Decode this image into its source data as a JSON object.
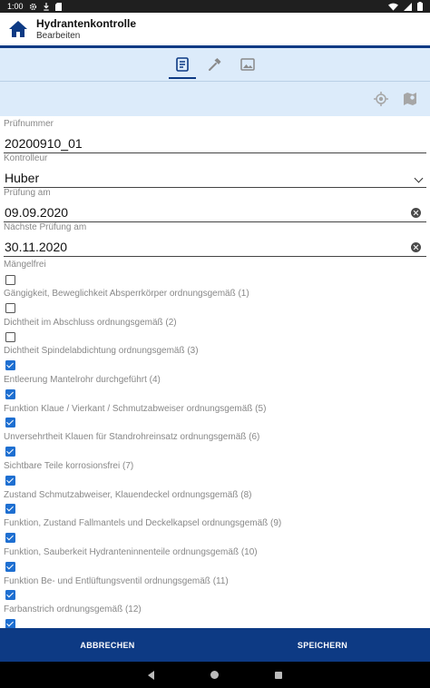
{
  "statusbar": {
    "time": "1:00"
  },
  "appbar": {
    "title": "Hydrantenkontrolle",
    "subtitle": "Bearbeiten"
  },
  "tabs": [
    {
      "icon": "form-icon",
      "active": true
    },
    {
      "icon": "hammer-icon",
      "active": false
    },
    {
      "icon": "image-icon",
      "active": false
    }
  ],
  "fields": {
    "pruefnummer": {
      "label": "Prüfnummer",
      "value": "20200910_01"
    },
    "kontrolleur": {
      "label": "Kontrolleur",
      "value": "Huber"
    },
    "pruefung_am": {
      "label": "Prüfung am",
      "value": "09.09.2020"
    },
    "naechste_pruefung": {
      "label": "Nächste Prüfung am",
      "value": "30.11.2020"
    }
  },
  "checks": [
    {
      "label": "Mängelfrei",
      "checked": false
    },
    {
      "label": "Gängigkeit, Beweglichkeit Absperrkörper ordnungsgemäß (1)",
      "checked": false
    },
    {
      "label": "Dichtheit im Abschluss ordnungsgemäß (2)",
      "checked": false
    },
    {
      "label": "Dichtheit Spindelabdichtung ordnungsgemäß (3)",
      "checked": true
    },
    {
      "label": "Entleerung Mantelrohr durchgeführt (4)",
      "checked": true
    },
    {
      "label": "Funktion Klaue / Vierkant / Schmutzabweiser ordnungsgemäß (5)",
      "checked": true
    },
    {
      "label": "Unversehrtheit Klauen für Standrohreinsatz ordnungsgemäß (6)",
      "checked": true
    },
    {
      "label": "Sichtbare Teile korrosionsfrei (7)",
      "checked": true
    },
    {
      "label": "Zustand Schmutzabweiser, Klauendeckel ordnungsgemäß (8)",
      "checked": true
    },
    {
      "label": "Funktion, Zustand Fallmantels und Deckelkapsel ordnungsgemäß (9)",
      "checked": true
    },
    {
      "label": "Funktion, Sauberkeit Hydranteninnenteile ordnungsgemäß (10)",
      "checked": true
    },
    {
      "label": "Funktion Be- und Entlüftungsventil ordnungsgemäß (11)",
      "checked": true
    },
    {
      "label": "Farbanstrich ordnungsgemäß (12)",
      "checked": true
    }
  ],
  "actions": {
    "cancel": "ABBRECHEN",
    "save": "SPEICHERN"
  },
  "colors": {
    "primary": "#0d3a84",
    "tint": "#dcebfa",
    "checkbox": "#1e6fd1"
  }
}
